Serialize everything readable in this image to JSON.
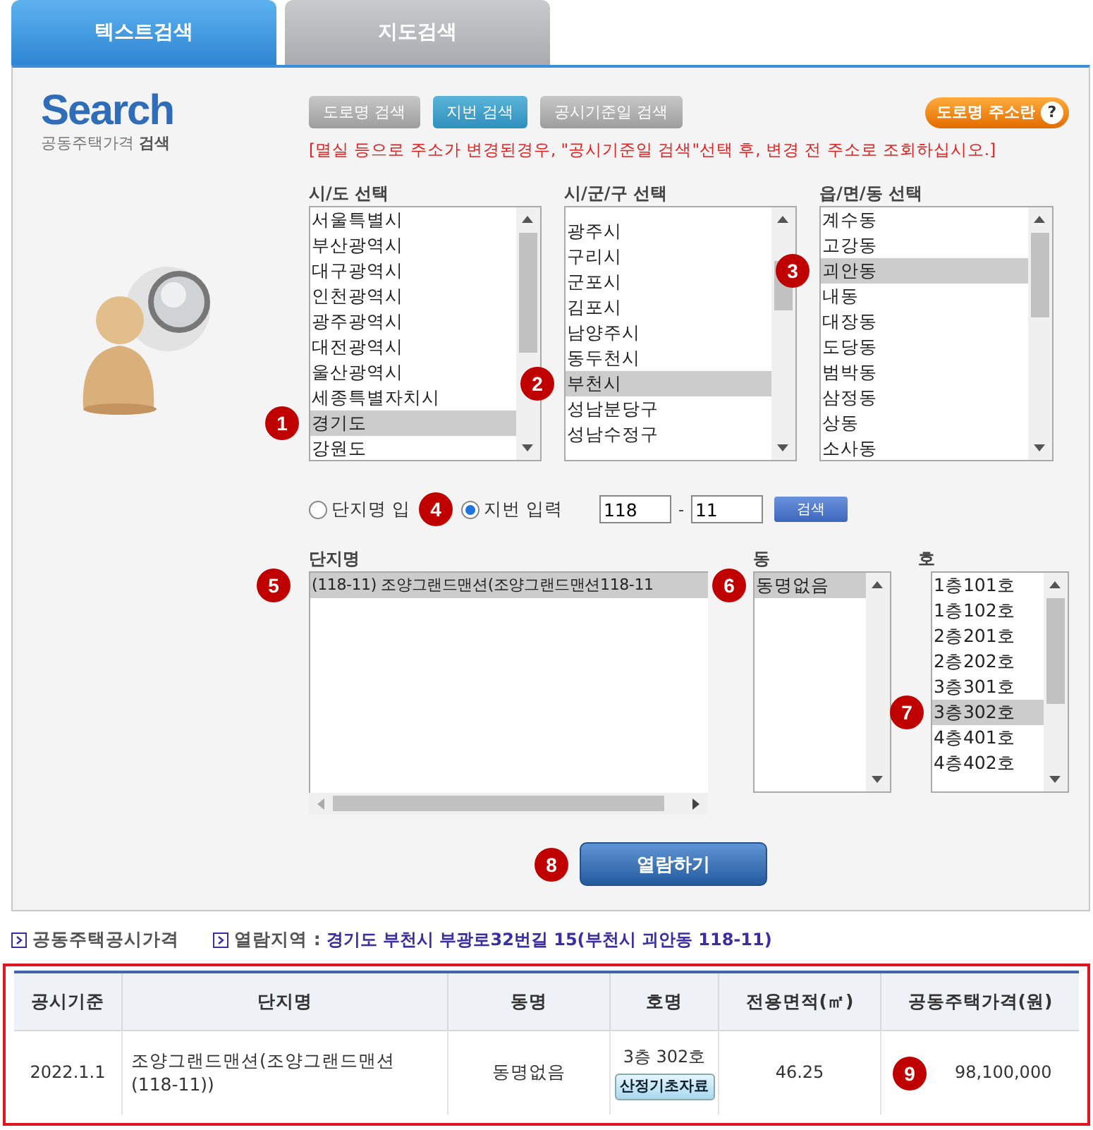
{
  "tabs": [
    {
      "label": "텍스트검색",
      "selected": true
    },
    {
      "label": "지도검색",
      "selected": false
    }
  ],
  "logo": {
    "title": "Search",
    "subtitle": "공동주택가격",
    "subtitle_bold": "검색"
  },
  "search_modes": [
    {
      "label": "도로명 검색",
      "selected": false
    },
    {
      "label": "지번 검색",
      "selected": true
    },
    {
      "label": "공시기준일 검색",
      "selected": false
    }
  ],
  "help_button": {
    "label": "도로명 주소란",
    "icon": "?"
  },
  "notice": "[멸실 등으로 주소가 변경된경우, \"공시기준일 검색\"선택 후, 변경 전 주소로 조회하십시오.]",
  "region_lists": [
    {
      "heading": "시/도 선택",
      "marker": "1",
      "items": [
        {
          "label": "서울특별시",
          "selected": false
        },
        {
          "label": "부산광역시",
          "selected": false
        },
        {
          "label": "대구광역시",
          "selected": false
        },
        {
          "label": "인천광역시",
          "selected": false
        },
        {
          "label": "광주광역시",
          "selected": false
        },
        {
          "label": "대전광역시",
          "selected": false
        },
        {
          "label": "울산광역시",
          "selected": false
        },
        {
          "label": "세종특별자치시",
          "selected": false
        },
        {
          "label": "경기도",
          "selected": true
        },
        {
          "label": "강원도",
          "selected": false
        }
      ]
    },
    {
      "heading": "시/군/구 선택",
      "marker": "2",
      "items": [
        {
          "label": "광주시",
          "selected": false
        },
        {
          "label": "구리시",
          "selected": false
        },
        {
          "label": "군포시",
          "selected": false
        },
        {
          "label": "김포시",
          "selected": false
        },
        {
          "label": "남양주시",
          "selected": false
        },
        {
          "label": "동두천시",
          "selected": false
        },
        {
          "label": "부천시",
          "selected": true
        },
        {
          "label": "성남분당구",
          "selected": false
        },
        {
          "label": "성남수정구",
          "selected": false
        }
      ]
    },
    {
      "heading": "읍/면/동 선택",
      "marker": "3",
      "items": [
        {
          "label": "계수동",
          "selected": false
        },
        {
          "label": "고강동",
          "selected": false
        },
        {
          "label": "괴안동",
          "selected": true
        },
        {
          "label": "내동",
          "selected": false
        },
        {
          "label": "대장동",
          "selected": false
        },
        {
          "label": "도당동",
          "selected": false
        },
        {
          "label": "범박동",
          "selected": false
        },
        {
          "label": "삼정동",
          "selected": false
        },
        {
          "label": "상동",
          "selected": false
        },
        {
          "label": "소사동",
          "selected": false
        }
      ]
    }
  ],
  "input_modes": [
    {
      "label": "단지명 입",
      "selected": false,
      "marker": "4"
    },
    {
      "label": "지번 입력",
      "selected": true
    }
  ],
  "lot_number": {
    "main": "118",
    "separator": "-",
    "sub": "11",
    "search_button": "검색"
  },
  "complex_lists": [
    {
      "heading": "단지명",
      "marker": "5",
      "items": [
        {
          "label": "(118-11) 조양그랜드맨션(조양그랜드맨션118-11",
          "selected": true
        }
      ]
    },
    {
      "heading": "동",
      "marker": "6",
      "items": [
        {
          "label": "동명없음",
          "selected": true
        }
      ]
    },
    {
      "heading": "호",
      "marker": "7",
      "items": [
        {
          "label": "1층101호",
          "selected": false
        },
        {
          "label": "1층102호",
          "selected": false
        },
        {
          "label": "2층201호",
          "selected": false
        },
        {
          "label": "2층202호",
          "selected": false
        },
        {
          "label": "3층301호",
          "selected": false
        },
        {
          "label": "3층302호",
          "selected": true
        },
        {
          "label": "4층401호",
          "selected": false
        },
        {
          "label": "4층402호",
          "selected": false
        }
      ]
    }
  ],
  "view_button": {
    "label": "열람하기",
    "marker": "8"
  },
  "info": [
    {
      "label": "공동주택공시가격"
    },
    {
      "label": "열람지역 :",
      "value": "경기도 부천시 부광로32번길 15(부천시 괴안동 118-11)"
    }
  ],
  "table": {
    "columns": [
      "공시기준",
      "단지명",
      "동명",
      "호명",
      "전용면적(㎡)",
      "공동주택가격(원)"
    ],
    "rows": [
      {
        "date": "2022.1.1",
        "complex": "조양그랜드맨션(조양그랜드맨션(118-11))",
        "dong": "동명없음",
        "ho": "3층 302호",
        "ho_button": "산정기초자료",
        "area": "46.25",
        "price": "98,100,000",
        "marker": "9"
      }
    ]
  }
}
